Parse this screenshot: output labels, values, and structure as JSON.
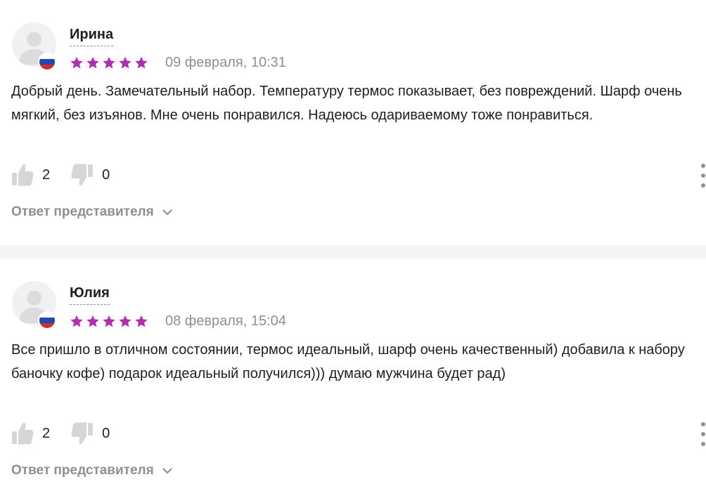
{
  "reviews": [
    {
      "author": "Ирина",
      "rating": 5,
      "date": "09 февраля, 10:31",
      "text": "Добрый день. Замечательный набор. Температуру термос показывает, без повреждений. Шарф очень мягкий, без изъянов. Мне очень понравился. Надеюсь одариваемому тоже понравиться.",
      "likes": "2",
      "dislikes": "0",
      "reply_label": "Ответ представителя"
    },
    {
      "author": "Юлия",
      "rating": 5,
      "date": "08 февраля, 15:04",
      "text": "Все пришло в отличном состоянии, термос идеальный, шарф очень качественный) добавила к набору баночку кофе) подарок идеальный получился))) думаю мужчина будет рад)",
      "likes": "2",
      "dislikes": "0",
      "reply_label": "Ответ представителя"
    }
  ],
  "colors": {
    "star": "#b12cb0",
    "muted_text": "#8f8f8f",
    "icon_gray": "#d6d6d8",
    "separator": "#f4f4f5",
    "flag_blue": "#1f4bb0",
    "flag_red": "#d52b2b"
  },
  "icons": {
    "avatar": "user-silhouette-icon",
    "flag": "russia-flag-icon",
    "star": "star-icon",
    "like": "thumbs-up-icon",
    "dislike": "thumbs-down-icon",
    "more": "vertical-dots-icon",
    "expand": "chevron-down-icon"
  }
}
